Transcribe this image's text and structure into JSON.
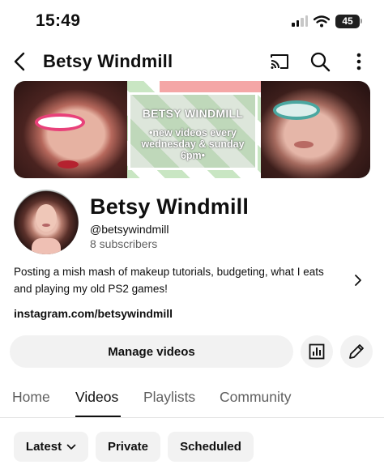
{
  "status_bar": {
    "time": "15:49",
    "battery": "45"
  },
  "header": {
    "title": "Betsy Windmill"
  },
  "banner": {
    "title": "BETSY WINDMILL",
    "subtitle_lines": [
      "•new videos every",
      "wednesday & sunday",
      "6pm•"
    ]
  },
  "channel": {
    "name": "Betsy Windmill",
    "handle": "@betsywindmill",
    "subscribers": "8 subscribers",
    "description_lines": [
      "Posting a mish mash of makeup tutorials, budgeting, what I eats",
      "and playing my old PS2 games!"
    ],
    "link": "instagram.com/betsywindmill"
  },
  "actions": {
    "manage_label": "Manage videos"
  },
  "tabs": [
    {
      "label": "Home",
      "active": false
    },
    {
      "label": "Videos",
      "active": true
    },
    {
      "label": "Playlists",
      "active": false
    },
    {
      "label": "Community",
      "active": false
    }
  ],
  "chips": [
    {
      "label": "Latest",
      "has_dropdown": true
    },
    {
      "label": "Private",
      "has_dropdown": false
    },
    {
      "label": "Scheduled",
      "has_dropdown": false
    }
  ],
  "icons": {
    "back": "chevron-left-icon",
    "cast": "cast-icon",
    "search": "search-icon",
    "more": "more-vertical-icon",
    "stats": "bar-chart-icon",
    "edit": "pencil-icon",
    "expand": "chevron-right-icon"
  },
  "colors": {
    "accent_text": "#0f0f0f",
    "secondary_text": "#606060",
    "chip_bg": "#f2f2f2"
  }
}
